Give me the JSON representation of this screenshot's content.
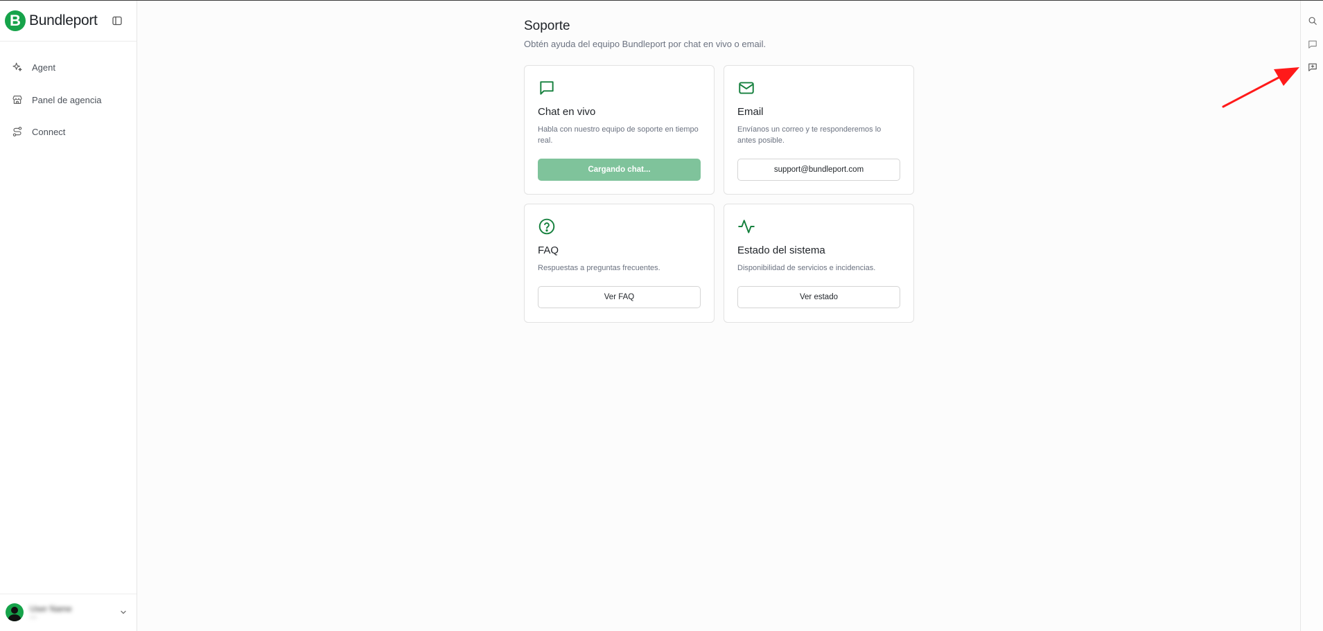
{
  "brand": {
    "name": "Bundleport",
    "logo_letter": "B",
    "accent_color": "#16a34a"
  },
  "sidebar": {
    "items": [
      {
        "label": "Agent",
        "icon": "sparkles-icon"
      },
      {
        "label": "Panel de agencia",
        "icon": "store-icon"
      },
      {
        "label": "Connect",
        "icon": "route-icon"
      }
    ],
    "user": {
      "name": "User Name",
      "sub": "—"
    }
  },
  "main": {
    "title": "Soporte",
    "subtitle": "Obtén ayuda del equipo Bundleport por chat en vivo o email.",
    "cards": [
      {
        "icon": "chat-icon",
        "title": "Chat en vivo",
        "description": "Habla con nuestro equipo de soporte en tiempo real.",
        "button": "Cargando chat..."
      },
      {
        "icon": "mail-icon",
        "title": "Email",
        "description": "Envíanos un correo y te responderemos lo antes posible.",
        "button": "support@bundleport.com"
      },
      {
        "icon": "help-circle-icon",
        "title": "FAQ",
        "description": "Respuestas a preguntas frecuentes.",
        "button": "Ver FAQ"
      },
      {
        "icon": "activity-icon",
        "title": "Estado del sistema",
        "description": "Disponibilidad de servicios e incidencias.",
        "button": "Ver estado"
      }
    ]
  },
  "right_rail": {
    "icons": [
      "search-icon",
      "message-icon",
      "feedback-icon"
    ]
  },
  "colors": {
    "button_loading": "#7fc39b",
    "icon_green": "#15803d",
    "annotation_arrow": "#ff1a1a"
  }
}
